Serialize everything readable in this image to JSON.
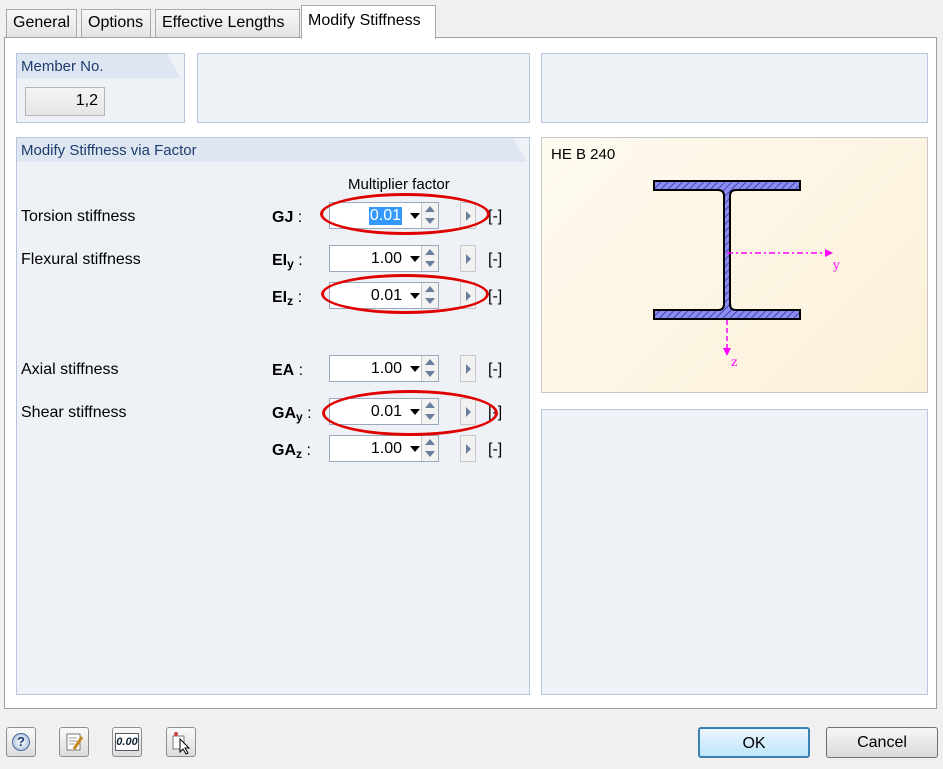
{
  "tabs": [
    {
      "label": "General"
    },
    {
      "label": "Options"
    },
    {
      "label": "Effective Lengths"
    },
    {
      "label": "Modify Stiffness"
    }
  ],
  "member": {
    "title": "Member No.",
    "value": "1,2"
  },
  "stiffness_group": {
    "title": "Modify Stiffness via Factor",
    "column_header": "Multiplier factor",
    "rows": [
      {
        "label": "Torsion stiffness",
        "sym": "GJ",
        "sub": "",
        "value": "0.01",
        "unit": "[-]",
        "selected": true,
        "highlighted": true
      },
      {
        "label": "Flexural stiffness",
        "sym": "EI",
        "sub": "y",
        "value": "1.00",
        "unit": "[-]",
        "selected": false,
        "highlighted": false
      },
      {
        "label": "",
        "sym": "EI",
        "sub": "z",
        "value": "0.01",
        "unit": "[-]",
        "selected": false,
        "highlighted": true
      },
      {
        "label": "Axial stiffness",
        "sym": "EA",
        "sub": "",
        "value": "1.00",
        "unit": "[-]",
        "selected": false,
        "highlighted": false
      },
      {
        "label": "Shear stiffness",
        "sym": "GA",
        "sub": "y",
        "value": "0.01",
        "unit": "[-]",
        "selected": false,
        "highlighted": true
      },
      {
        "label": "",
        "sym": "GA",
        "sub": "z",
        "value": "1.00",
        "unit": "[-]",
        "selected": false,
        "highlighted": false
      }
    ]
  },
  "section": {
    "name": "HE B 240",
    "axis_y": "y",
    "axis_z": "z",
    "fill_color": "#8d8df0",
    "axis_color": "#ff00ff"
  },
  "colors": {
    "highlight_ring": "#e00000",
    "group_title": "#1e3c6e"
  },
  "footer": {
    "icons": [
      "help-icon",
      "edit-icon",
      "decimal-places-icon",
      "pick-icon"
    ],
    "decimal_icon_text": "0.00",
    "ok_label": "OK",
    "cancel_label": "Cancel"
  }
}
